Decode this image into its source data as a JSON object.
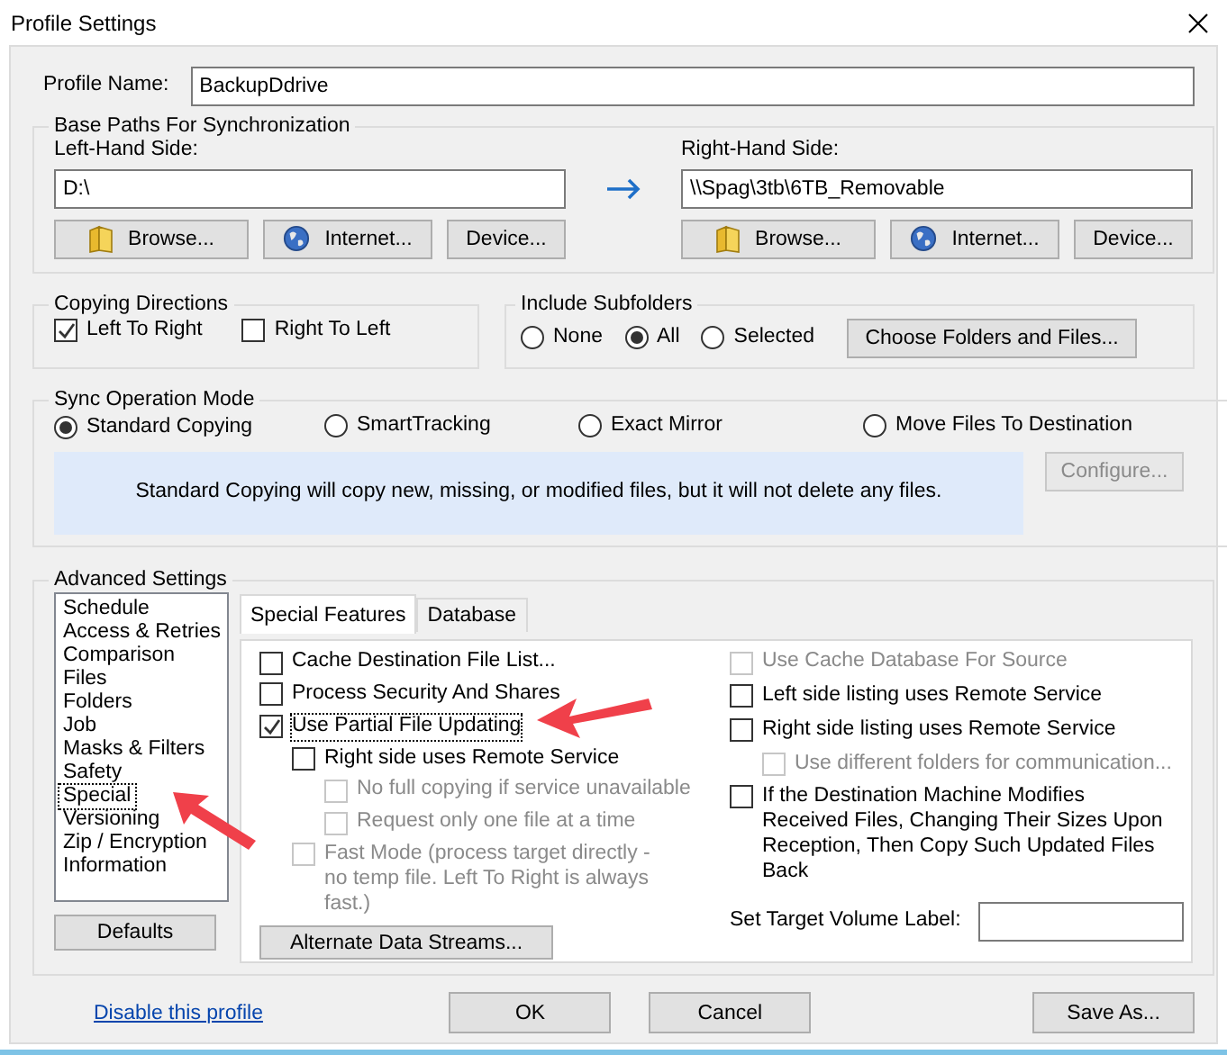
{
  "window": {
    "title": "Profile Settings"
  },
  "profile_name": {
    "label": "Profile Name:",
    "value": "BackupDdrive"
  },
  "base_paths": {
    "title": "Base Paths For Synchronization",
    "left": {
      "label": "Left-Hand Side:",
      "value": "D:\\",
      "buttons": [
        {
          "kind": "browse",
          "label": "Browse..."
        },
        {
          "kind": "internet",
          "label": "Internet..."
        },
        {
          "kind": "device",
          "label": "Device..."
        }
      ]
    },
    "right": {
      "label": "Right-Hand Side:",
      "value": "\\\\Spag\\3tb\\6TB_Removable",
      "buttons": [
        {
          "kind": "browse",
          "label": "Browse..."
        },
        {
          "kind": "internet",
          "label": "Internet..."
        },
        {
          "kind": "device",
          "label": "Device..."
        }
      ]
    }
  },
  "copying_directions": {
    "title": "Copying Directions",
    "options": [
      {
        "label": "Left To Right",
        "checked": true
      },
      {
        "label": "Right To Left",
        "checked": false
      }
    ]
  },
  "include_subfolders": {
    "title": "Include Subfolders",
    "options": [
      {
        "label": "None",
        "selected": false
      },
      {
        "label": "All",
        "selected": true
      },
      {
        "label": "Selected",
        "selected": false
      }
    ],
    "button": "Choose Folders and Files..."
  },
  "sync_mode": {
    "title": "Sync Operation Mode",
    "options": [
      {
        "label": "Standard Copying",
        "selected": true
      },
      {
        "label": "SmartTracking",
        "selected": false
      },
      {
        "label": "Exact Mirror",
        "selected": false
      },
      {
        "label": "Move Files To Destination",
        "selected": false
      }
    ],
    "description": "Standard Copying will copy new, missing, or modified files, but it will not delete any files.",
    "configure": {
      "label": "Configure...",
      "disabled": true
    }
  },
  "advanced": {
    "title": "Advanced Settings",
    "categories": [
      {
        "label": "Schedule",
        "selected": false
      },
      {
        "label": "Access & Retries",
        "selected": false
      },
      {
        "label": "Comparison",
        "selected": false
      },
      {
        "label": "Files",
        "selected": false
      },
      {
        "label": "Folders",
        "selected": false
      },
      {
        "label": "Job",
        "selected": false
      },
      {
        "label": "Masks & Filters",
        "selected": false
      },
      {
        "label": "Safety",
        "selected": false
      },
      {
        "label": "Special",
        "selected": true
      },
      {
        "label": "Versioning",
        "selected": false
      },
      {
        "label": "Zip / Encryption",
        "selected": false
      },
      {
        "label": "Information",
        "selected": false
      }
    ],
    "defaults_button": "Defaults",
    "tabs": [
      {
        "label": "Special Features",
        "selected": true
      },
      {
        "label": "Database",
        "selected": false
      }
    ],
    "left_options": [
      {
        "label": "Cache Destination File List...",
        "checked": false,
        "disabled": false,
        "focused": false
      },
      {
        "label": "Process Security And Shares",
        "checked": false,
        "disabled": false,
        "focused": false
      },
      {
        "label": "Use Partial File Updating",
        "checked": true,
        "disabled": false,
        "focused": true,
        "children": [
          {
            "label": "Right side uses Remote Service",
            "checked": false,
            "disabled": false,
            "focused": false,
            "children": [
              {
                "label": "No full copying if service unavailable",
                "checked": false,
                "disabled": true,
                "focused": false
              },
              {
                "label": "Request only one file at a time",
                "checked": false,
                "disabled": true,
                "focused": false
              }
            ]
          },
          {
            "label": "Fast Mode (process target directly - no temp file. Left To Right is always fast.)",
            "checked": false,
            "disabled": true,
            "focused": false
          }
        ]
      }
    ],
    "alternate_streams_button": "Alternate Data Streams...",
    "right_options": [
      {
        "label": "Use Cache Database For Source",
        "checked": false,
        "disabled": true,
        "focused": false
      },
      {
        "label": "Left side listing uses Remote Service",
        "checked": false,
        "disabled": false,
        "focused": false
      },
      {
        "label": "Right side listing uses Remote Service",
        "checked": false,
        "disabled": false,
        "focused": false,
        "children": [
          {
            "label": "Use different folders for communication...",
            "checked": false,
            "disabled": true,
            "focused": false
          }
        ]
      },
      {
        "label": "If the Destination Machine Modifies Received Files, Changing Their Sizes Upon Reception, Then Copy Such Updated Files Back",
        "checked": false,
        "disabled": false,
        "focused": false
      }
    ],
    "volume_label": {
      "label": "Set Target Volume Label:"
    }
  },
  "footer": {
    "link": "Disable this profile",
    "buttons": [
      "OK",
      "Cancel",
      "Save As..."
    ]
  }
}
